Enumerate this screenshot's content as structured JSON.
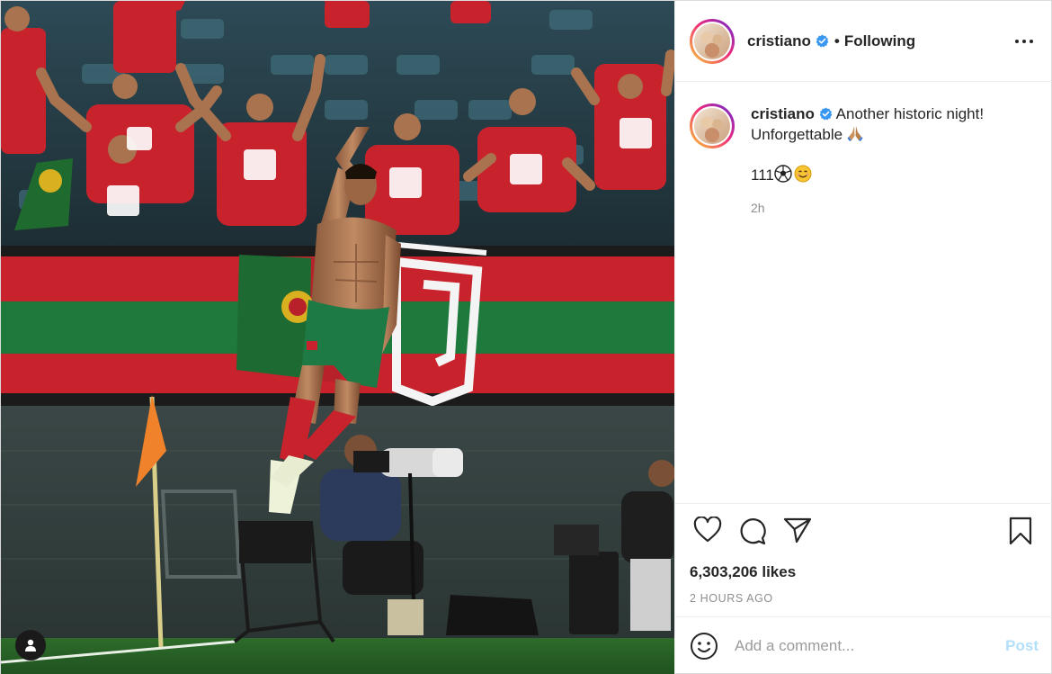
{
  "post": {
    "username": "cristiano",
    "separator": "•",
    "follow_status": "Following",
    "verified": true,
    "accent_color": "#0095f6",
    "link_disabled_color": "#b2dffc"
  },
  "caption": {
    "username": "cristiano",
    "text_line1": "Another historic night!",
    "text_line2": "Unforgettable",
    "extra_line": "111",
    "time": "2h"
  },
  "engagement": {
    "likes": "6,303,206 likes",
    "time_ago": "2 HOURS AGO"
  },
  "comment_box": {
    "placeholder": "Add a comment...",
    "post_label": "Post"
  },
  "icons": {
    "more": "more-options-icon",
    "like": "heart-icon",
    "comment": "comment-bubble-icon",
    "share": "paper-plane-icon",
    "save": "bookmark-icon",
    "emoji": "smiley-icon",
    "tags": "user-tag-icon"
  }
}
